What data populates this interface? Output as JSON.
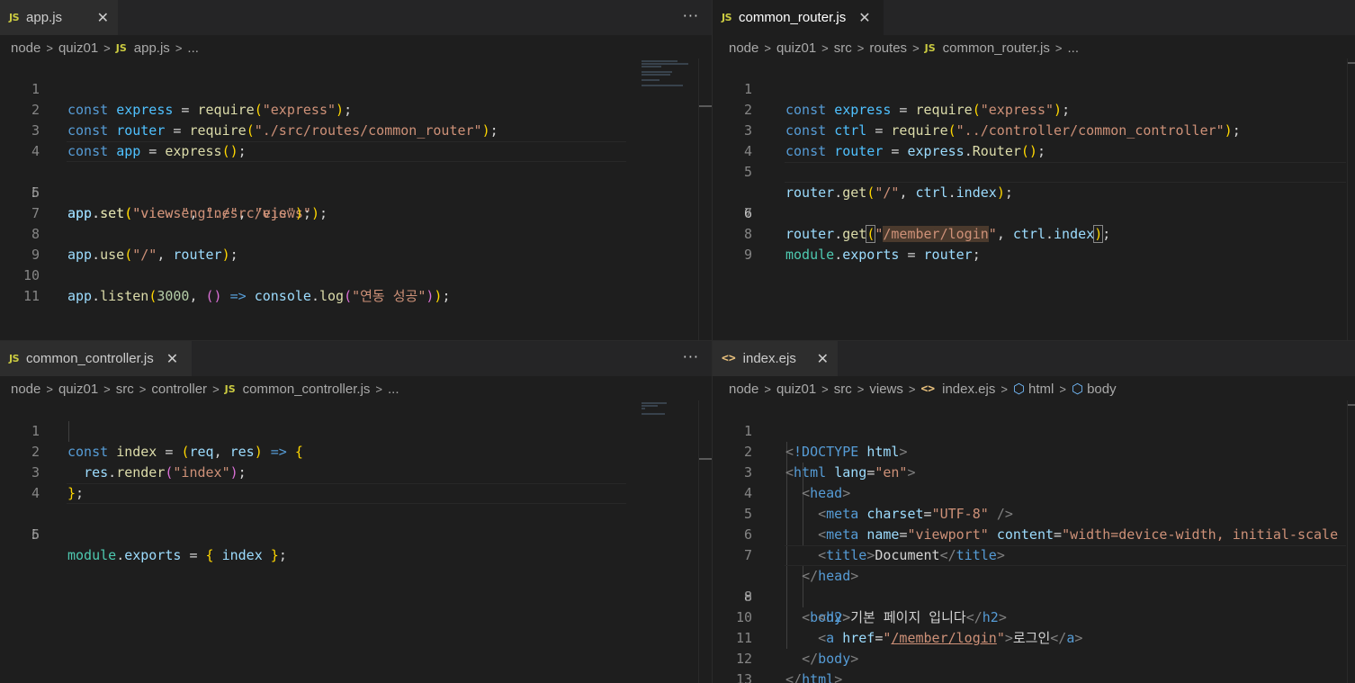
{
  "panes": {
    "top_left": {
      "tab": {
        "icon": "JS",
        "label": "app.js",
        "close": "✕"
      },
      "more": "···",
      "breadcrumb": [
        "node",
        "quiz01",
        "app.js",
        "..."
      ],
      "lines": [
        "1",
        "2",
        "3",
        "4",
        "5",
        "6",
        "7",
        "8",
        "9",
        "10",
        "11"
      ]
    },
    "top_right": {
      "tab": {
        "icon": "JS",
        "label": "common_router.js",
        "close": "✕"
      },
      "breadcrumb": [
        "node",
        "quiz01",
        "src",
        "routes",
        "common_router.js",
        "..."
      ],
      "lines": [
        "1",
        "2",
        "3",
        "4",
        "5",
        "6",
        "7",
        "8",
        "9"
      ]
    },
    "bottom_left": {
      "tab": {
        "icon": "JS",
        "label": "common_controller.js",
        "close": "✕"
      },
      "more": "···",
      "breadcrumb": [
        "node",
        "quiz01",
        "src",
        "controller",
        "common_controller.js",
        "..."
      ],
      "lines": [
        "1",
        "2",
        "3",
        "4",
        "5",
        "6"
      ]
    },
    "bottom_right": {
      "tab": {
        "icon": "<>",
        "label": "index.ejs",
        "close": "✕"
      },
      "breadcrumb": [
        "node",
        "quiz01",
        "src",
        "views",
        "index.ejs",
        "html",
        "body"
      ],
      "lines": [
        "1",
        "2",
        "3",
        "4",
        "5",
        "6",
        "7",
        "8",
        "9",
        "10",
        "11",
        "12",
        "13"
      ]
    }
  },
  "code": {
    "app_js": [
      "const express = require(\"express\");",
      "const router = require(\"./src/routes/common_router\");",
      "const app = express();",
      "",
      "app.set(\"views\", \"./src/views\");",
      "app.set(\"view engine\", \"ejs\");",
      "",
      "app.use(\"/\", router);",
      "",
      "app.listen(3000, () => console.log(\"연동 성공\"));",
      ""
    ],
    "router_js": [
      "const express = require(\"express\");",
      "const ctrl = require(\"../controller/common_controller\");",
      "const router = express.Router();",
      "",
      "router.get(\"/\", ctrl.index);",
      "router.get(\"/member/login\", ctrl.index);",
      "",
      "module.exports = router;",
      ""
    ],
    "controller_js": [
      "const index = (req, res) => {",
      "  res.render(\"index\");",
      "};",
      "",
      "module.exports = { index };",
      ""
    ],
    "index_ejs": [
      "<!DOCTYPE html>",
      "<html lang=\"en\">",
      "  <head>",
      "    <meta charset=\"UTF-8\" />",
      "    <meta name=\"viewport\" content=\"width=device-width, initial-scale",
      "    <title>Document</title>",
      "  </head>",
      "  <body>",
      "    <h2>기본 페이지 입니다</h2>",
      "    <a href=\"/member/login\">로그인</a>",
      "  </body>",
      "</html>",
      ""
    ]
  },
  "colors": {
    "background": "#1e1e1e",
    "keyword": "#569cd6",
    "variable": "#9cdcfe",
    "function": "#dcdcaa",
    "string": "#ce9178",
    "number": "#b5cea8",
    "js_icon": "#cbcb41"
  }
}
